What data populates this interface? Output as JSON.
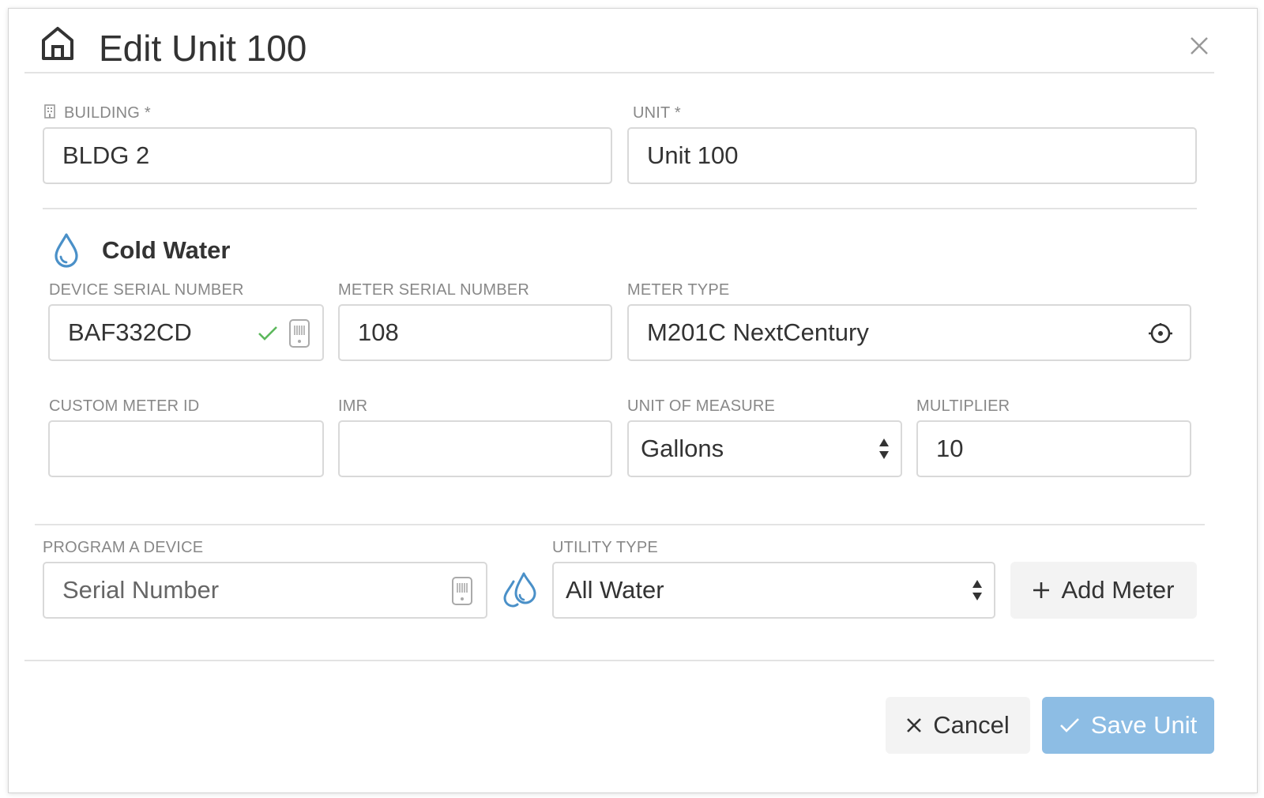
{
  "header": {
    "title": "Edit Unit 100",
    "icon": "home-icon",
    "close_icon": "close-icon"
  },
  "building": {
    "label": "BUILDING *",
    "value": "BLDG 2",
    "icon": "building-icon"
  },
  "unit": {
    "label": "UNIT *",
    "value": "Unit 100"
  },
  "meter_section": {
    "title": "Cold Water",
    "icon": "water-drop-icon",
    "device_serial": {
      "label": "DEVICE SERIAL NUMBER",
      "value": "BAF332CD",
      "status_icon": "check-icon",
      "action_icon": "device-icon"
    },
    "meter_serial": {
      "label": "METER SERIAL NUMBER",
      "value": "108"
    },
    "meter_type": {
      "label": "METER TYPE",
      "value": "M201C NextCentury",
      "icon": "meter-icon"
    },
    "custom_meter_id": {
      "label": "CUSTOM METER ID",
      "value": ""
    },
    "imr": {
      "label": "IMR",
      "value": ""
    },
    "unit_of_measure": {
      "label": "UNIT OF MEASURE",
      "value": "Gallons"
    },
    "multiplier": {
      "label": "MULTIPLIER",
      "value": "10"
    }
  },
  "program_device": {
    "label": "PROGRAM A DEVICE",
    "placeholder": "Serial Number",
    "icon": "device-icon",
    "utility_icon": "water-drops-icon",
    "utility_type": {
      "label": "UTILITY TYPE",
      "value": "All Water"
    },
    "add_meter": {
      "label": "Add Meter",
      "icon": "plus-icon"
    }
  },
  "footer": {
    "cancel": {
      "label": "Cancel",
      "icon": "close-icon"
    },
    "save": {
      "label": "Save Unit",
      "icon": "check-icon"
    }
  },
  "colors": {
    "accent": "#4a90c8",
    "save_button": "#8dbde4",
    "check_green": "#5cb85c",
    "border": "#d9d9d9"
  }
}
